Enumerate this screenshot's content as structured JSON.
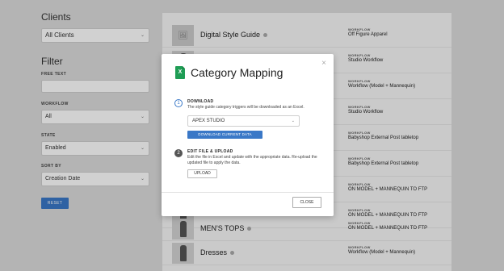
{
  "sidebar": {
    "clients_heading": "Clients",
    "clients_select": "All Clients",
    "filter_heading": "Filter",
    "free_text_label": "FREE TEXT",
    "workflow_label": "WORKFLOW",
    "workflow_value": "All",
    "state_label": "STATE",
    "state_value": "Enabled",
    "sort_label": "SORT BY",
    "sort_value": "Creation Date",
    "reset_label": "RESET"
  },
  "list": {
    "workflow_label": "WORKFLOW",
    "rows": [
      {
        "name": "Digital Style Guide",
        "workflow": "Off Figure Apparel"
      },
      {
        "name": "",
        "workflow": "Studio Workflow"
      },
      {
        "name": "",
        "workflow": "Workflow (Model + Mannequin)"
      },
      {
        "name": "",
        "workflow": "Studio Workflow"
      },
      {
        "name": "",
        "workflow": "Babyshop External Post tabletop"
      },
      {
        "name": "",
        "workflow": "Babyshop External Post tabletop"
      },
      {
        "name": "",
        "workflow": "ON MODEL + MANNEQUIN TO FTP"
      },
      {
        "name": "",
        "workflow": "ON MODEL + MANNEQUIN TO FTP"
      },
      {
        "name": "MEN'S TOPS",
        "workflow": "ON MODEL + MANNEQUIN TO FTP"
      },
      {
        "name": "Dresses",
        "workflow": "Workflow (Model + Mannequin)"
      }
    ]
  },
  "modal": {
    "title": "Category Mapping",
    "excel_icon_letter": "X",
    "close_icon": "×",
    "step1": {
      "number": "1",
      "heading": "DOWNLOAD",
      "description": "The style guide category triggers will be downloaded as an Excel.",
      "select_value": "APEX STUDIO",
      "button_label": "DOWNLOAD CURRENT DATA"
    },
    "step2": {
      "number": "2",
      "heading": "EDIT FILE & UPLOAD",
      "description": "Edit the file in Excel and update with the appropriate data. Re-upload the updated file to apply the data.",
      "button_label": "UPLOAD"
    },
    "footer_close": "CLOSE"
  },
  "colors": {
    "accent": "#3a78c7",
    "excel_green": "#1f9d55"
  }
}
